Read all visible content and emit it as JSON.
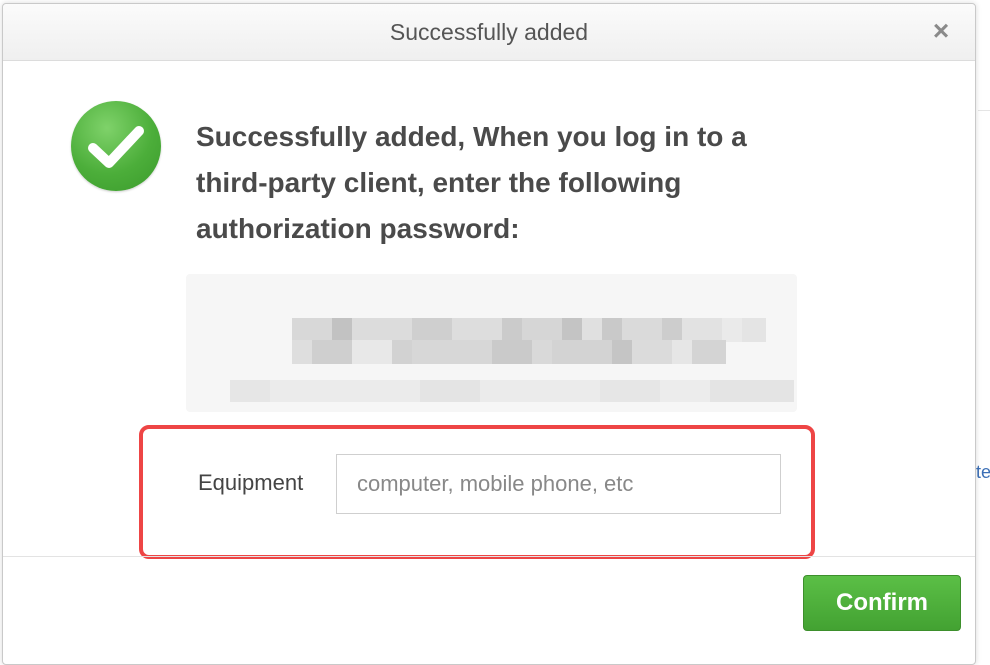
{
  "dialog": {
    "title": "Successfully added",
    "close_icon": "×",
    "message": "Successfully added, When you log in to a third-party client, enter the following authorization password:",
    "password_obscured": true
  },
  "equipment": {
    "label": "Equipment",
    "placeholder": "computer, mobile phone, etc",
    "value": ""
  },
  "footer": {
    "confirm_label": "Confirm"
  },
  "icons": {
    "success": "checkmark-circle-icon",
    "close": "close-icon"
  },
  "colors": {
    "success_green": "#4cae3a",
    "confirm_green": "#4aa838",
    "highlight_red": "#ee4545"
  },
  "background": {
    "right_fragment": "te"
  }
}
